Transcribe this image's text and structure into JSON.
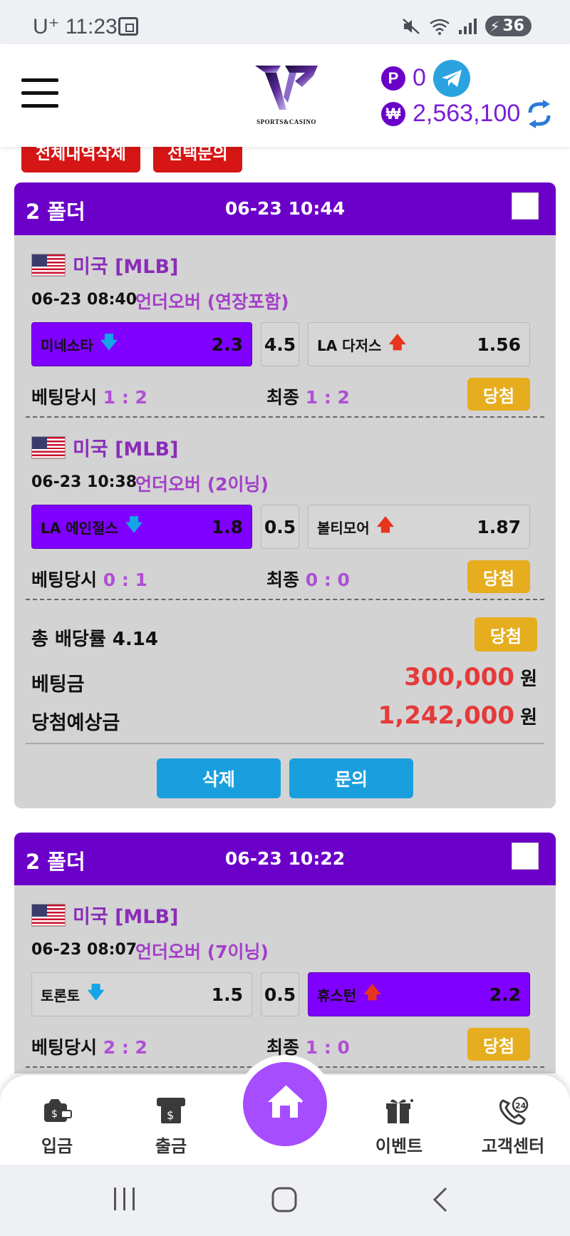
{
  "status_bar": {
    "carrier_time": "U⁺ 11:23",
    "battery": "36"
  },
  "header": {
    "logo_text": "SPORTS&CASINO",
    "points_badge": "P",
    "points": "0",
    "currency_badge": "₩",
    "balance": "2,563,100"
  },
  "top_buttons": {
    "delete_all": "전체내역삭제",
    "select_inquiry": "선택문의"
  },
  "cards": [
    {
      "title": "2 폴더",
      "date": "06-23 10:44",
      "matches": [
        {
          "league": "미국 [MLB]",
          "time": "06-23 08:40",
          "type": "언더오버 (연장포함)",
          "home": "미네소타",
          "home_odds": "2.3",
          "line": "4.5",
          "away": "LA 다저스",
          "away_odds": "1.56",
          "bet_label": "베팅당시",
          "bet_score": "1 : 2",
          "final_label": "최종",
          "final_score": "1 : 2",
          "result": "당첨"
        },
        {
          "league": "미국 [MLB]",
          "time": "06-23 10:38",
          "type": "언더오버 (2이닝)",
          "home": "LA 에인절스",
          "home_odds": "1.8",
          "line": "0.5",
          "away": "볼티모어",
          "away_odds": "1.87",
          "bet_label": "베팅당시",
          "bet_score": "0 : 1",
          "final_label": "최종",
          "final_score": "0 : 0",
          "result": "당첨"
        }
      ],
      "total_odds_label": "총 배당률 4.14",
      "total_result": "당첨",
      "stake_label": "베팅금",
      "stake": "300,000",
      "expected_label": "당첨예상금",
      "expected": "1,242,000",
      "won": "원",
      "delete_label": "삭제",
      "inquiry_label": "문의"
    },
    {
      "title": "2 폴더",
      "date": "06-23 10:22",
      "matches": [
        {
          "league": "미국 [MLB]",
          "time": "06-23 08:07",
          "type": "언더오버 (7이닝)",
          "home": "토론토",
          "home_odds": "1.5",
          "line": "0.5",
          "away": "휴스턴",
          "away_odds": "2.2",
          "bet_label": "베팅당시",
          "bet_score": "2 : 2",
          "final_label": "최종",
          "final_score": "1 : 0",
          "result": "당첨"
        }
      ]
    }
  ],
  "bottom_nav": {
    "deposit": "입금",
    "withdraw": "출금",
    "event": "이벤트",
    "support": "고객센터"
  },
  "colors": {
    "purple": "#6b00c9",
    "selected": "#7f00ff",
    "win": "#e6ad1e",
    "red": "#d61515",
    "blue": "#1a9fde"
  }
}
